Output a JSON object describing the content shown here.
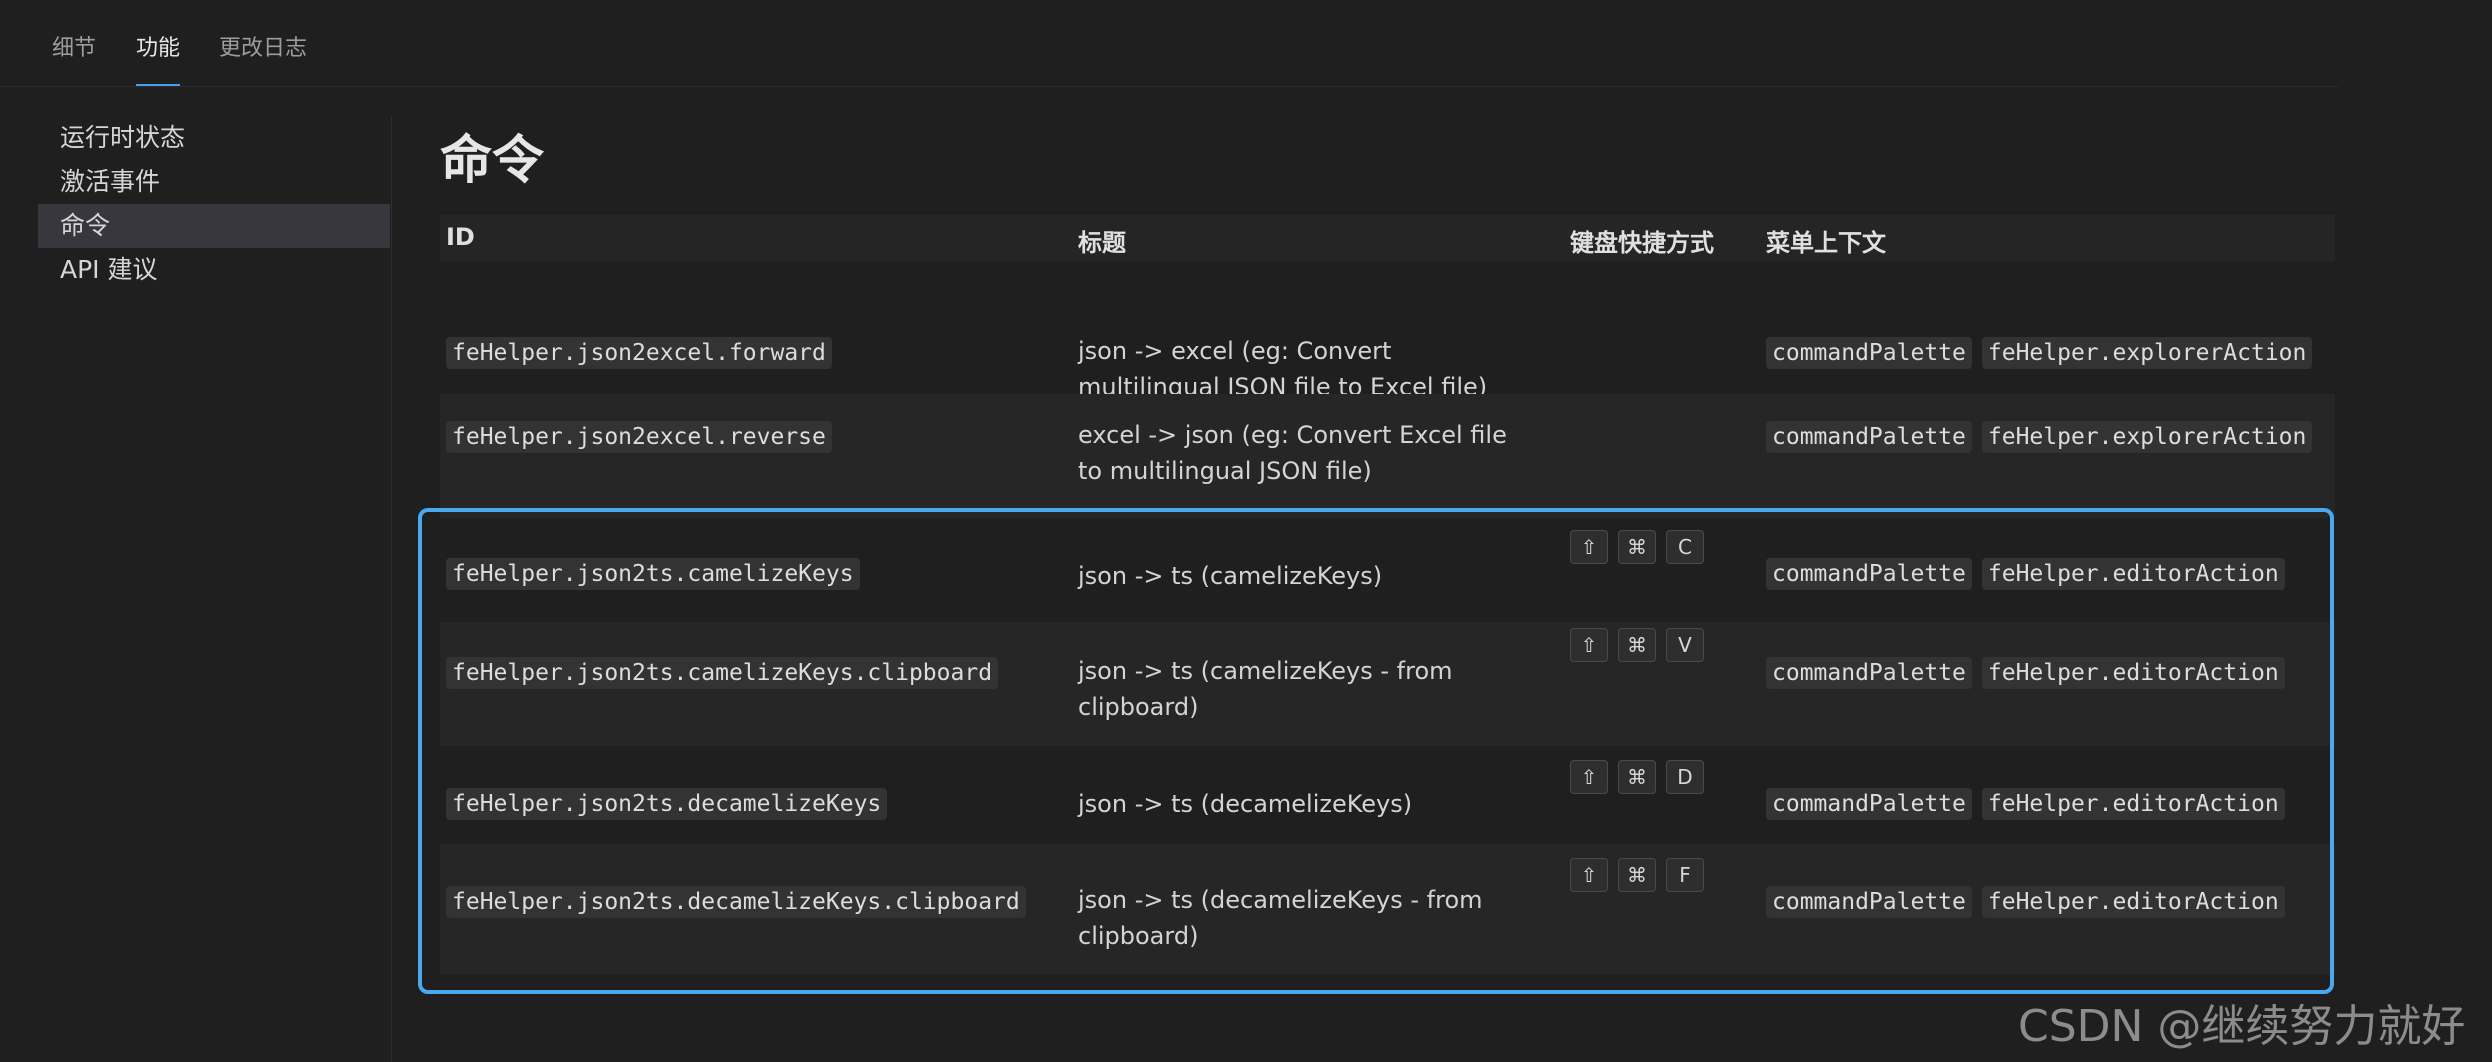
{
  "tabs": [
    "细节",
    "功能",
    "更改日志"
  ],
  "sidebar": [
    "运行时状态",
    "激活事件",
    "命令",
    "API 建议"
  ],
  "page_title": "命令",
  "table": {
    "headers": [
      "ID",
      "标题",
      "键盘快捷方式",
      "菜单上下文"
    ],
    "rows": [
      {
        "id": "feHelper.json2excel.forward",
        "title": "json -> excel (eg: Convert multilingual JSON file to Excel file)",
        "keys": [],
        "menus": [
          "commandPalette",
          "feHelper.explorerAction"
        ]
      },
      {
        "id": "feHelper.json2excel.reverse",
        "title": "excel -> json (eg: Convert Excel file to multilingual JSON file)",
        "keys": [],
        "menus": [
          "commandPalette",
          "feHelper.explorerAction"
        ]
      },
      {
        "id": "feHelper.json2ts.camelizeKeys",
        "title": "json -> ts (camelizeKeys)",
        "keys": [
          "⇧",
          "⌘",
          "C"
        ],
        "menus": [
          "commandPalette",
          "feHelper.editorAction"
        ]
      },
      {
        "id": "feHelper.json2ts.camelizeKeys.clipboard",
        "title": "json -> ts (camelizeKeys - from clipboard)",
        "keys": [
          "⇧",
          "⌘",
          "V"
        ],
        "menus": [
          "commandPalette",
          "feHelper.editorAction"
        ]
      },
      {
        "id": "feHelper.json2ts.decamelizeKeys",
        "title": "json -> ts (decamelizeKeys)",
        "keys": [
          "⇧",
          "⌘",
          "D"
        ],
        "menus": [
          "commandPalette",
          "feHelper.editorAction"
        ]
      },
      {
        "id": "feHelper.json2ts.decamelizeKeys.clipboard",
        "title": "json -> ts (decamelizeKeys - from clipboard)",
        "keys": [
          "⇧",
          "⌘",
          "F"
        ],
        "menus": [
          "commandPalette",
          "feHelper.editorAction"
        ]
      }
    ]
  },
  "watermark": "CSDN @继续努力就好",
  "colors": {
    "background": "#1f1f1f",
    "accent": "#4d9df0",
    "highlight_border": "#4aa8ec"
  }
}
